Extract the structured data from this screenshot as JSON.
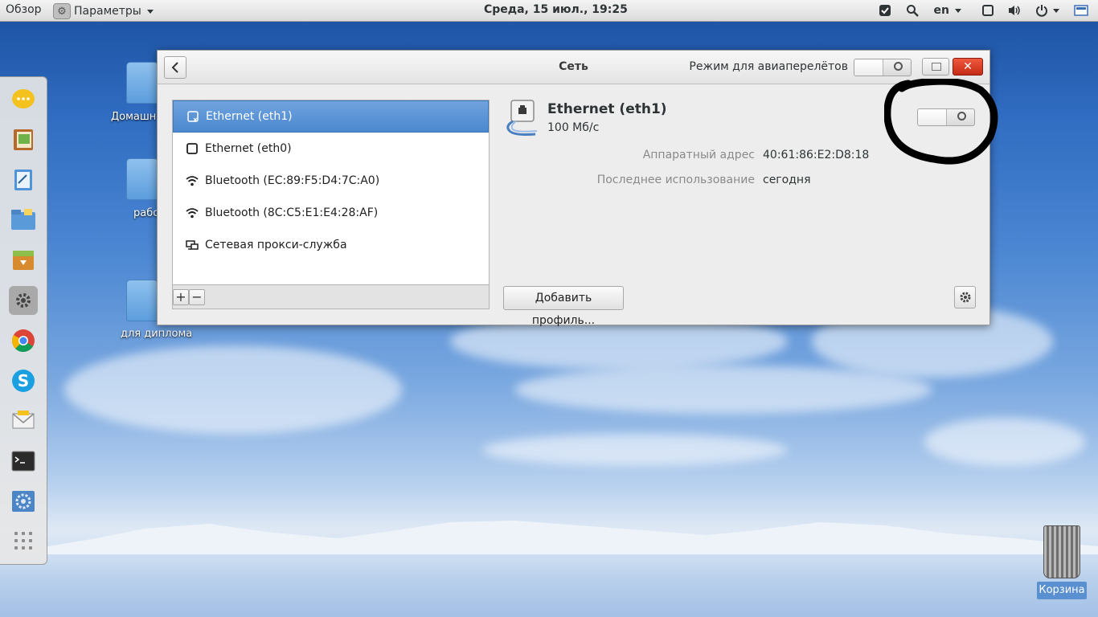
{
  "topbar": {
    "activities": "Обзор",
    "app_menu": "Параметры",
    "clock": "Среда, 15 июл., 19:25",
    "language": "en",
    "icons": [
      "check-icon",
      "search-icon",
      "window-icon",
      "volume-icon",
      "power-icon",
      "display-icon"
    ]
  },
  "dock": {
    "items": [
      "chat-icon",
      "notes-icon",
      "editor-icon",
      "files-icon",
      "archive-icon",
      "settings-icon",
      "chrome-icon",
      "skype-icon",
      "mail-icon",
      "terminal-icon",
      "system-icon"
    ]
  },
  "desktop": {
    "icons": [
      {
        "label": "Домашн"
      },
      {
        "label": "рабо"
      },
      {
        "label": "для диплома"
      }
    ],
    "trash_label": "Корзина"
  },
  "window": {
    "title": "Сеть",
    "airplane_label": "Режим для авиаперелётов",
    "close_symbol": "✕"
  },
  "devices": [
    {
      "name": "Ethernet (eth1)",
      "icon": "ethernet-icon",
      "selected": true
    },
    {
      "name": "Ethernet (eth0)",
      "icon": "ethernet-icon",
      "selected": false
    },
    {
      "name": "Bluetooth (EC:89:F5:D4:7C:A0)",
      "icon": "wifi-icon",
      "selected": false
    },
    {
      "name": "Bluetooth (8C:C5:E1:E4:28:AF)",
      "icon": "wifi-icon",
      "selected": false
    },
    {
      "name": "Сетевая прокси-служба",
      "icon": "proxy-icon",
      "selected": false
    }
  ],
  "list_toolbar": {
    "add": "+",
    "remove": "−"
  },
  "detail": {
    "device_name": "Ethernet (eth1)",
    "speed": "100 Мб/с",
    "hw_address_label": "Аппаратный адрес",
    "hw_address": "40:61:86:E2:D8:18",
    "last_used_label": "Последнее использование",
    "last_used": "сегодня",
    "add_profile": "Добавить профиль..."
  }
}
